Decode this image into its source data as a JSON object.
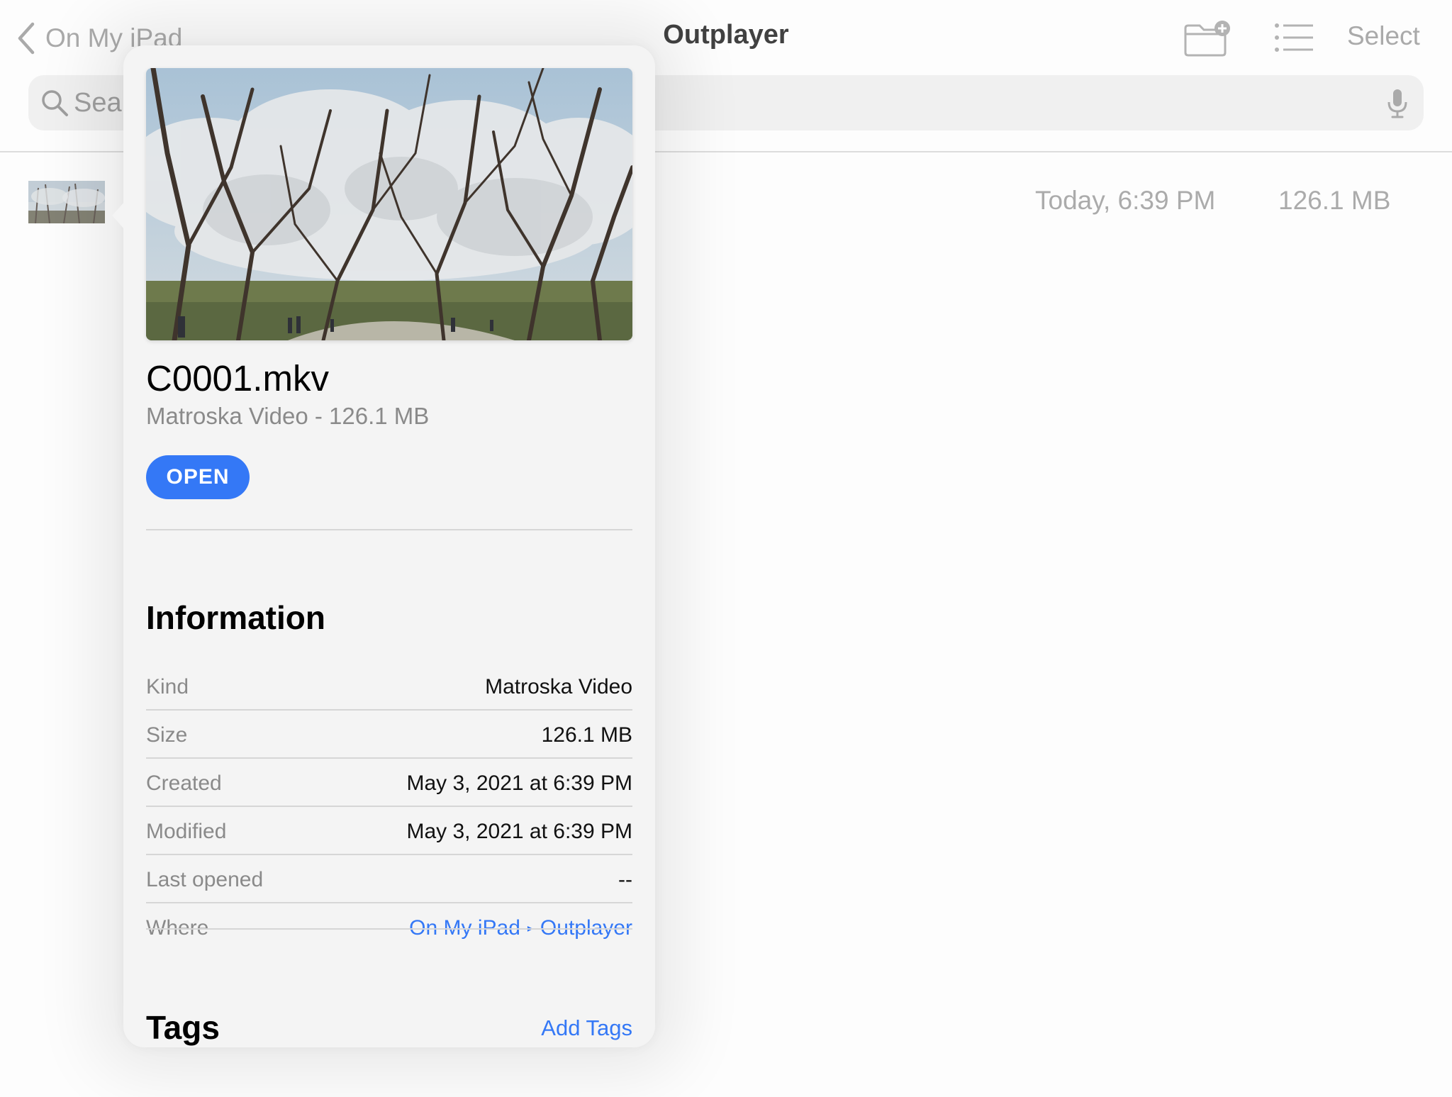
{
  "navbar": {
    "back_label": "On My iPad",
    "title": "Outplayer",
    "select_label": "Select"
  },
  "search": {
    "placeholder": "Search"
  },
  "file_list": {
    "rows": [
      {
        "date": "Today, 6:39 PM",
        "size": "126.1 MB"
      }
    ]
  },
  "popover": {
    "file_name": "C0001.mkv",
    "subtitle": "Matroska Video - 126.1 MB",
    "open_label": "OPEN",
    "info_heading": "Information",
    "info": [
      {
        "label": "Kind",
        "value": "Matroska Video"
      },
      {
        "label": "Size",
        "value": "126.1 MB"
      },
      {
        "label": "Created",
        "value": "May 3, 2021 at 6:39 PM"
      },
      {
        "label": "Modified",
        "value": "May 3, 2021 at 6:39 PM"
      },
      {
        "label": "Last opened",
        "value": "--"
      }
    ],
    "where": {
      "label": "Where",
      "path": [
        "On My iPad",
        "Outplayer"
      ]
    },
    "tags_heading": "Tags",
    "add_tags_label": "Add Tags"
  },
  "icons": {
    "back": "chevron-left-icon",
    "new_folder": "folder-plus-icon",
    "list_view": "list-icon",
    "search": "search-icon",
    "mic": "microphone-icon"
  },
  "colors": {
    "accent": "#3478f6",
    "secondary_text": "#8a8a8a",
    "popover_background": "#f4f4f4"
  }
}
